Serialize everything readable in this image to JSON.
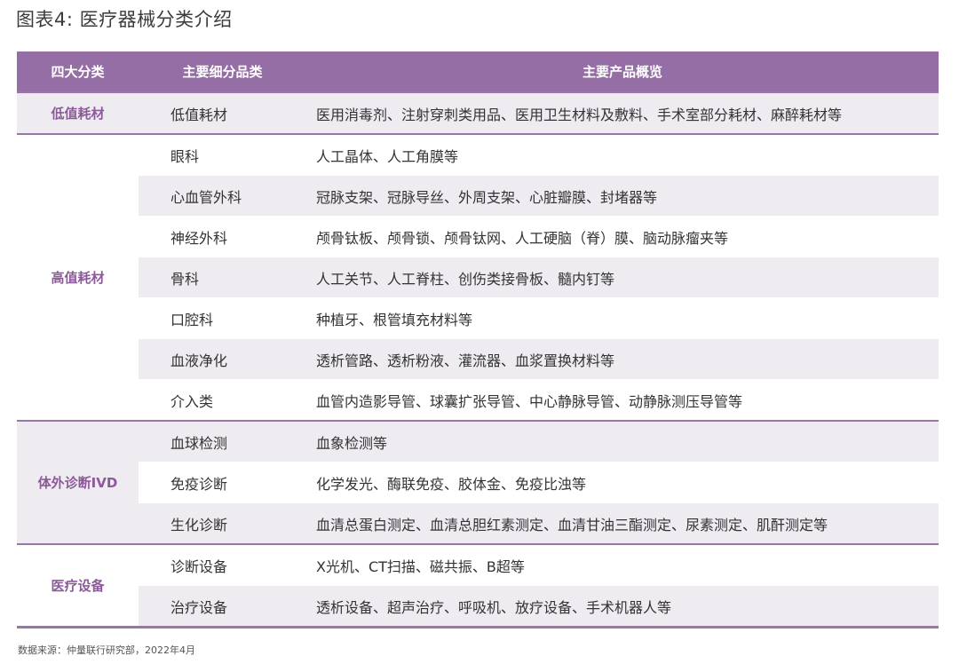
{
  "title": "图表4: 医疗器械分类介绍",
  "table": {
    "headers": [
      "四大分类",
      "主要细分品类",
      "主要产品概览"
    ],
    "groups": [
      {
        "category": "低值耗材",
        "rows": [
          {
            "sub": "低值耗材",
            "products": "医用消毒剂、注射穿刺类用品、医用卫生材料及敷料、手术室部分耗材、麻醉耗材等"
          }
        ]
      },
      {
        "category": "高值耗材",
        "rows": [
          {
            "sub": "眼科",
            "products": "人工晶体、人工角膜等"
          },
          {
            "sub": "心血管外科",
            "products": "冠脉支架、冠脉导丝、外周支架、心脏瓣膜、封堵器等"
          },
          {
            "sub": "神经外科",
            "products": "颅骨钛板、颅骨锁、颅骨钛网、人工硬脑（脊）膜、脑动脉瘤夹等"
          },
          {
            "sub": "骨科",
            "products": "人工关节、人工脊柱、创伤类接骨板、髓内钉等"
          },
          {
            "sub": "口腔科",
            "products": "种植牙、根管填充材料等"
          },
          {
            "sub": "血液净化",
            "products": "透析管路、透析粉液、灌流器、血浆置换材料等"
          },
          {
            "sub": "介入类",
            "products": "血管内造影导管、球囊扩张导管、中心静脉导管、动静脉测压导管等"
          }
        ]
      },
      {
        "category": "体外诊断IVD",
        "rows": [
          {
            "sub": "血球检测",
            "products": "血象检测等"
          },
          {
            "sub": "免疫诊断",
            "products": "化学发光、酶联免疫、胶体金、免疫比浊等"
          },
          {
            "sub": "生化诊断",
            "products": "血清总蛋白测定、血清总胆红素测定、血清甘油三酯测定、尿素测定、肌酐测定等"
          }
        ]
      },
      {
        "category": "医疗设备",
        "rows": [
          {
            "sub": "诊断设备",
            "products": "X光机、CT扫描、磁共振、B超等"
          },
          {
            "sub": "治疗设备",
            "products": "透析设备、超声治疗、呼吸机、放疗设备、手术机器人等"
          }
        ]
      }
    ]
  },
  "source": "数据来源：仲量联行研究部，2022年4月"
}
